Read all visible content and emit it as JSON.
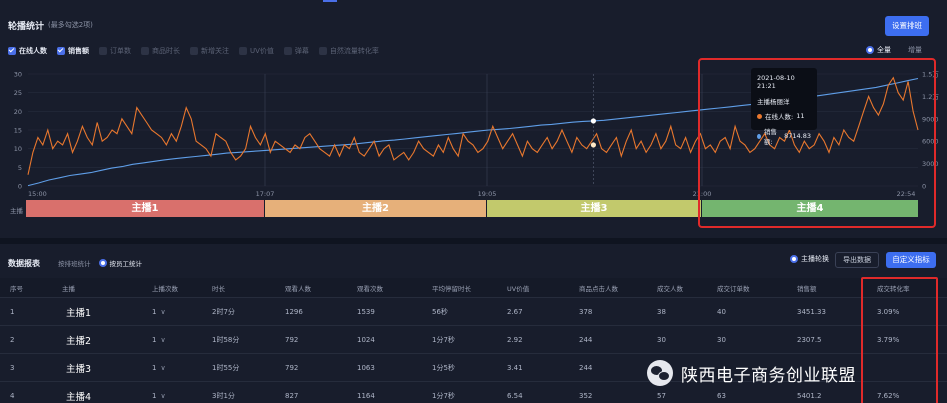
{
  "top": {
    "title": "轮播统计",
    "subtitle": "(最多勾选2项)",
    "setting_button": "设置排班",
    "metrics": [
      {
        "label": "在线人数",
        "checked": true
      },
      {
        "label": "销售额",
        "checked": true
      },
      {
        "label": "订单数",
        "checked": false
      },
      {
        "label": "商品时长",
        "checked": false
      },
      {
        "label": "新增关注",
        "checked": false
      },
      {
        "label": "UV价值",
        "checked": false
      },
      {
        "label": "弹幕",
        "checked": false
      },
      {
        "label": "自然流量转化率",
        "checked": false
      }
    ],
    "scope_all": "全量",
    "scope_inc": "增量",
    "anchor_axis_label": "主播"
  },
  "tooltip": {
    "time": "2021-08-10 21:21",
    "anchor": "主播杨丽洋",
    "online_label": "在线人数:",
    "online_value": "11",
    "sales_label": "销售额:",
    "sales_value": "8714.83"
  },
  "chart_data": {
    "type": "line",
    "x_ticks": [
      "15:00",
      "17:07",
      "19:05",
      "21:00",
      "22:54"
    ],
    "y_left_ticks": [
      "0",
      "5",
      "10",
      "15",
      "20",
      "25",
      "30"
    ],
    "y_right_ticks": [
      "0",
      "3000",
      "6000",
      "9000",
      "1.2万",
      "1.5万"
    ],
    "ylim_left": [
      0,
      30
    ],
    "ylim_right": [
      0,
      15000
    ],
    "series": [
      {
        "name": "在线人数",
        "axis": "left",
        "color": "#e8772e",
        "values": [
          3,
          9,
          13,
          11,
          15,
          10,
          12,
          11,
          14,
          9,
          12,
          16,
          13,
          11,
          17,
          12,
          13,
          15,
          14,
          18,
          16,
          14,
          21,
          19,
          17,
          15,
          14,
          13,
          11,
          14,
          12,
          16,
          21,
          18,
          12,
          11,
          10,
          8,
          14,
          13,
          12,
          9,
          7,
          8,
          10,
          16,
          13,
          11,
          14,
          9,
          12,
          11,
          10,
          9,
          11,
          10,
          13,
          14,
          12,
          10,
          9,
          8,
          11,
          8,
          11,
          10,
          13,
          9,
          8,
          10,
          12,
          8,
          10,
          11,
          7,
          8,
          9,
          7,
          9,
          12,
          10,
          9,
          8,
          11,
          9,
          13,
          10,
          8,
          14,
          12,
          11,
          9,
          10,
          12,
          16,
          13,
          10,
          12,
          14,
          11,
          8,
          12,
          10,
          9,
          11,
          13,
          10,
          12,
          15,
          12,
          9,
          13,
          11,
          10,
          12,
          14,
          10,
          9,
          11,
          13,
          8,
          12,
          15,
          10,
          12,
          9,
          11,
          14,
          10,
          12,
          16,
          11,
          10,
          13,
          9,
          12,
          14,
          10,
          11,
          9,
          12,
          13,
          10,
          16,
          12,
          11,
          9,
          10,
          12,
          14,
          11,
          10,
          13,
          12,
          15,
          11,
          9,
          12,
          10,
          11,
          14,
          12,
          9,
          13,
          11,
          15,
          13,
          12,
          16,
          20,
          24,
          21,
          19,
          22,
          27,
          29,
          25,
          23,
          28,
          20,
          15
        ]
      },
      {
        "name": "销售额",
        "axis": "right",
        "color": "#5f9ee8",
        "values": [
          50,
          400,
          800,
          1100,
          1400,
          1600,
          1800,
          2100,
          2400,
          2600,
          2900,
          3100,
          3300,
          3500,
          3650,
          3800,
          3950,
          4100,
          4250,
          4400,
          4500,
          4600,
          4700,
          4800,
          4900,
          5000,
          5100,
          5200,
          5300,
          5400,
          5500,
          5600,
          5750,
          5900,
          6050,
          6150,
          6300,
          6450,
          6600,
          6750,
          6900,
          7050,
          7200,
          7350,
          7500,
          7600,
          7700,
          7850,
          8000,
          8150,
          8250,
          8400,
          8550,
          8650,
          8714.83,
          8800,
          8950,
          9100,
          9250,
          9400,
          9550,
          9700,
          9850,
          10000,
          10150,
          10300,
          10450,
          10600,
          10750,
          10900,
          11050,
          11200,
          11400,
          11600,
          11800,
          12000,
          12200,
          12400,
          12600,
          12800,
          13000,
          13200,
          13500,
          13800,
          14100,
          14400
        ]
      }
    ],
    "anchors": [
      {
        "name": "主播1",
        "color": "#d9706c"
      },
      {
        "name": "主播2",
        "color": "#e6b07a"
      },
      {
        "name": "主播3",
        "color": "#c2c96c"
      },
      {
        "name": "主播4",
        "color": "#74b56f"
      }
    ]
  },
  "table": {
    "title": "数据报表",
    "mode_1": "按排班统计",
    "mode_2": "按员工统计",
    "main_anchor_label": "主播轮换",
    "export_button": "导出数据",
    "custom_button": "自定义指标",
    "headers": [
      "序号",
      "主播",
      "上播次数",
      "时长",
      "观看人数",
      "观看次数",
      "平均停留时长",
      "UV价值",
      "商品点击人数",
      "成交人数",
      "成交订单数",
      "销售额",
      "成交转化率"
    ],
    "rows": [
      [
        "1",
        "主播1",
        "1",
        "2时7分",
        "1296",
        "1539",
        "56秒",
        "2.67",
        "378",
        "38",
        "40",
        "3451.33",
        "3.09%"
      ],
      [
        "2",
        "主播2",
        "1",
        "1时58分",
        "792",
        "1024",
        "1分7秒",
        "2.92",
        "244",
        "30",
        "30",
        "2307.5",
        "3.79%"
      ],
      [
        "3",
        "主播3",
        "1",
        "1时55分",
        "792",
        "1063",
        "1分5秒",
        "3.41",
        "244",
        "",
        "",
        "",
        ""
      ],
      [
        "4",
        "主播4",
        "1",
        "3时1分",
        "827",
        "1164",
        "1分7秒",
        "6.54",
        "352",
        "57",
        "63",
        "5401.2",
        "7.62%"
      ]
    ]
  },
  "watermark": {
    "text": "陕西电子商务创业联盟"
  },
  "colors": {
    "accent": "#3d6ef0",
    "highlight_border": "#e02a2a"
  }
}
